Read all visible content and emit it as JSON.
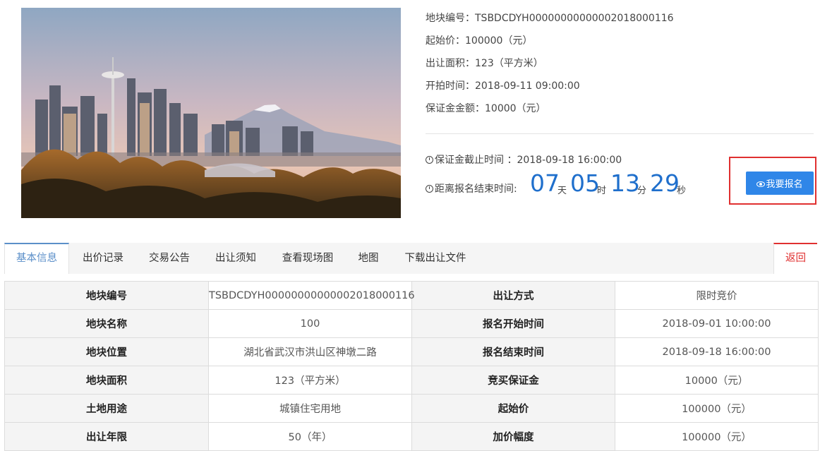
{
  "photo": {
    "alt_icon": "city-skyline-image"
  },
  "info": [
    {
      "label": "地块编号：",
      "value": "TSBDCDYH00000000000002018000116"
    },
    {
      "label": "起始价：",
      "value": "100000（元）"
    },
    {
      "label": "出让面积：",
      "value": "123（平方米）"
    },
    {
      "label": "开拍时间：",
      "value": "2018-09-11 09:00:00"
    },
    {
      "label": "保证金金额：",
      "value": "10000（元）"
    }
  ],
  "deadline": {
    "label": "保证金截止时间 ：",
    "value": "2018-09-18 16:00:00"
  },
  "countdown": {
    "label": "距离报名结束时间:",
    "days": "07",
    "days_unit": "天",
    "hours": "05",
    "hours_unit": "时",
    "minutes": "13",
    "minutes_unit": "分",
    "seconds": "29",
    "seconds_unit": "秒"
  },
  "signup_button": "我要报名",
  "tabs": [
    "基本信息",
    "出价记录",
    "交易公告",
    "出让须知",
    "查看现场图",
    "地图",
    "下载出让文件"
  ],
  "back_button": "返回",
  "table": [
    [
      "地块编号",
      "TSBDCDYH00000000000002018000116",
      "出让方式",
      "限时竞价"
    ],
    [
      "地块名称",
      "100",
      "报名开始时间",
      "2018-09-01 10:00:00"
    ],
    [
      "地块位置",
      "湖北省武汉市洪山区神墩二路",
      "报名结束时间",
      "2018-09-18 16:00:00"
    ],
    [
      "地块面积",
      "123（平方米）",
      "竞买保证金",
      "10000（元）"
    ],
    [
      "土地用途",
      "城镇住宅用地",
      "起始价",
      "100000（元）"
    ],
    [
      "出让年限",
      "50（年）",
      "加价幅度",
      "100000（元）"
    ]
  ],
  "colors": {
    "accent": "#2f86e8",
    "countdown": "#1f6fcc",
    "highlight": "#e03030",
    "tab_active": "#5b8fc9"
  }
}
